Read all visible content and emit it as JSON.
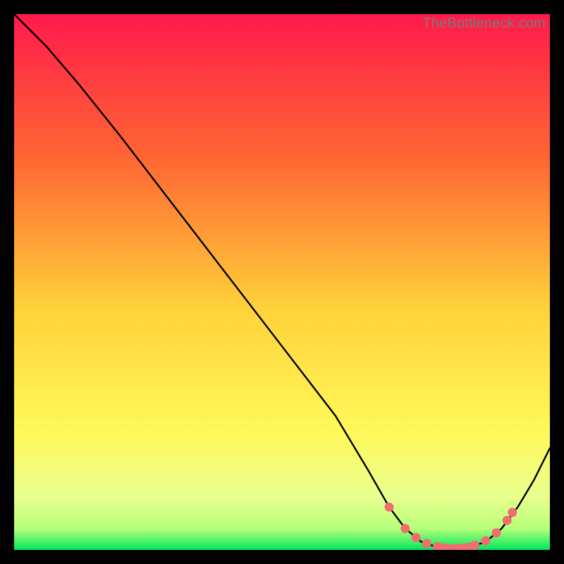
{
  "watermark": "TheBottleneck.com",
  "colors": {
    "gradient_top": "#ff1a4b",
    "gradient_mid1": "#ff7a2e",
    "gradient_mid2": "#ffe83a",
    "gradient_low": "#f7ff9e",
    "gradient_bottom": "#00e85b",
    "curve": "#000000",
    "marker_fill": "#f26d6d",
    "marker_stroke": "#f26d6d"
  },
  "chart_data": {
    "type": "line",
    "title": "",
    "xlabel": "",
    "ylabel": "",
    "xlim": [
      0,
      100
    ],
    "ylim": [
      0,
      100
    ],
    "series": [
      {
        "name": "bottleneck-curve",
        "x": [
          0,
          6,
          12,
          20,
          30,
          40,
          50,
          60,
          66,
          70,
          73,
          76,
          79,
          82,
          85,
          88,
          91,
          94,
          97,
          100
        ],
        "y": [
          100,
          94,
          87,
          77,
          64,
          51,
          38,
          25,
          15,
          8,
          4,
          1.5,
          0.5,
          0.2,
          0.5,
          1.5,
          4,
          8,
          13,
          19
        ]
      }
    ],
    "markers": {
      "name": "highlight-points",
      "x": [
        70,
        73,
        75,
        77,
        79,
        80,
        81,
        82,
        83,
        84,
        85,
        86,
        88,
        90,
        92,
        93
      ],
      "y": [
        8,
        4,
        2.3,
        1.2,
        0.6,
        0.4,
        0.3,
        0.2,
        0.3,
        0.4,
        0.5,
        0.9,
        1.7,
        3.2,
        5.5,
        7
      ]
    }
  }
}
